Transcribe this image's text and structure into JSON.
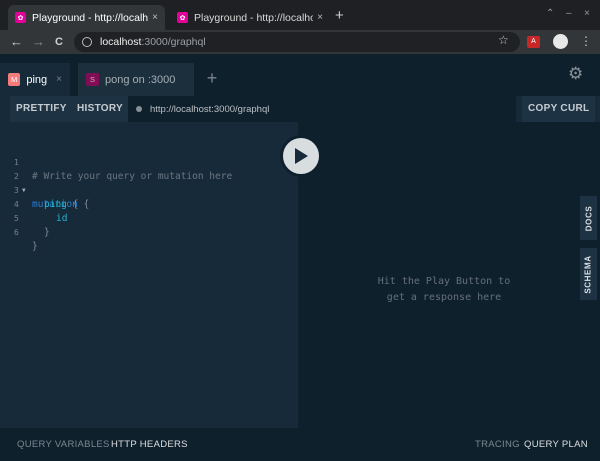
{
  "browser": {
    "tabs": [
      {
        "title": "Playground - http://localhost:",
        "active": true
      },
      {
        "title": "Playground - http://localhost:",
        "active": false
      }
    ],
    "new_tab_glyph": "+",
    "window_controls": [
      "⌃",
      "–",
      "×"
    ],
    "address": {
      "host": "localhost",
      "path": ":3000/graphql"
    },
    "nav": {
      "back": "←",
      "forward": "→",
      "reload": "C"
    },
    "extension_label": "A",
    "menu_glyph": "⋮",
    "star_glyph": "☆"
  },
  "playground": {
    "tabs": [
      {
        "badge": "M",
        "label": "ping",
        "active": true,
        "close": "×"
      },
      {
        "badge": "S",
        "label": "pong on :3000",
        "active": false
      }
    ],
    "add_tab_glyph": "+",
    "settings_icon": "gear-icon",
    "toolbar": {
      "prettify": "PRETTIFY",
      "history": "HISTORY",
      "endpoint": "http://localhost:3000/graphql",
      "copy_curl": "COPY CURL"
    },
    "editor": {
      "line_numbers": [
        "1",
        "2",
        "3",
        "4",
        "5",
        "6"
      ],
      "lines": [
        {
          "text": "# Write your query or mutation here"
        },
        {
          "keyword": "mutation",
          "brace": " {"
        },
        {
          "field": "ping",
          "brace": " {"
        },
        {
          "field": "id"
        },
        {
          "brace": "}"
        },
        {
          "brace": "}"
        }
      ]
    },
    "result_hint": [
      "Hit the Play Button to",
      "get a response here"
    ],
    "side_tabs": {
      "docs": "DOCS",
      "schema": "SCHEMA"
    },
    "footer": {
      "query_variables": "QUERY VARIABLES",
      "http_headers": "HTTP HEADERS",
      "tracing": "TRACING",
      "query_plan": "QUERY PLAN"
    }
  },
  "colors": {
    "background": "#172a3a",
    "panel_dark": "#0f202d",
    "keyword": "#2a7ed3",
    "field": "#1fb5cf",
    "graphql_pink": "#e10098"
  }
}
